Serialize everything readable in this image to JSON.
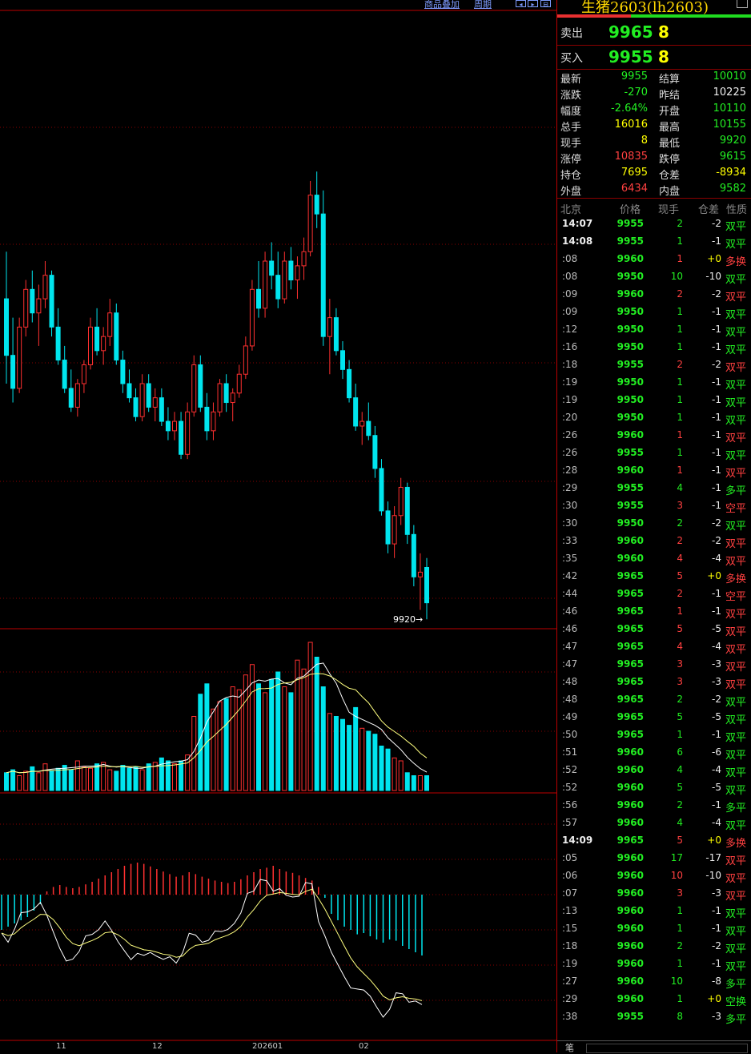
{
  "toolbar": {
    "link1": "商品叠加",
    "link2": "周期"
  },
  "x_axis_labels": [
    "11",
    "12",
    "202601",
    "02"
  ],
  "price_marker": "9920",
  "quote_panel": {
    "title": "生猪2603(lh2603)",
    "sell_label": "卖出",
    "sell_price": "9965",
    "sell_vol": "8",
    "buy_label": "买入",
    "buy_price": "9955",
    "buy_vol": "8",
    "stats": [
      {
        "l1": "最新",
        "v1": "9955",
        "c1": "g",
        "l2": "结算",
        "v2": "10010",
        "c2": "g"
      },
      {
        "l1": "涨跌",
        "v1": "-270",
        "c1": "g",
        "l2": "昨结",
        "v2": "10225",
        "c2": "w"
      },
      {
        "l1": "幅度",
        "v1": "-2.64%",
        "c1": "g",
        "l2": "开盘",
        "v2": "10110",
        "c2": "g"
      },
      {
        "l1": "总手",
        "v1": "16016",
        "c1": "y",
        "l2": "最高",
        "v2": "10155",
        "c2": "g"
      },
      {
        "l1": "现手",
        "v1": "8",
        "c1": "y",
        "l2": "最低",
        "v2": "9920",
        "c2": "g"
      },
      {
        "l1": "涨停",
        "v1": "10835",
        "c1": "r",
        "l2": "跌停",
        "v2": "9615",
        "c2": "g"
      },
      {
        "l1": "持仓",
        "v1": "7695",
        "c1": "y",
        "l2": "仓差",
        "v2": "-8934",
        "c2": "y"
      },
      {
        "l1": "外盘",
        "v1": "6434",
        "c1": "r",
        "l2": "内盘",
        "v2": "9582",
        "c2": "g"
      }
    ],
    "table_headers": [
      "北京",
      "价格",
      "现手",
      "仓差",
      "性质"
    ],
    "ticks": [
      {
        "time": "14:07",
        "price": "9955",
        "vol": "2",
        "oi": "-2",
        "nature": "双平",
        "vc": "g",
        "nc": "g"
      },
      {
        "time": "14:08",
        "price": "9955",
        "vol": "1",
        "oi": "-1",
        "nature": "双平",
        "vc": "g",
        "nc": "g"
      },
      {
        "time": ":08",
        "price": "9960",
        "vol": "1",
        "oi": "+0",
        "nature": "多换",
        "vc": "r",
        "nc": "r"
      },
      {
        "time": ":08",
        "price": "9950",
        "vol": "10",
        "oi": "-10",
        "nature": "双平",
        "vc": "g",
        "nc": "g"
      },
      {
        "time": ":09",
        "price": "9960",
        "vol": "2",
        "oi": "-2",
        "nature": "双平",
        "vc": "r",
        "nc": "r"
      },
      {
        "time": ":09",
        "price": "9950",
        "vol": "1",
        "oi": "-1",
        "nature": "双平",
        "vc": "g",
        "nc": "g"
      },
      {
        "time": ":12",
        "price": "9950",
        "vol": "1",
        "oi": "-1",
        "nature": "双平",
        "vc": "g",
        "nc": "g"
      },
      {
        "time": ":16",
        "price": "9950",
        "vol": "1",
        "oi": "-1",
        "nature": "双平",
        "vc": "g",
        "nc": "g"
      },
      {
        "time": ":18",
        "price": "9955",
        "vol": "2",
        "oi": "-2",
        "nature": "双平",
        "vc": "r",
        "nc": "r"
      },
      {
        "time": ":19",
        "price": "9950",
        "vol": "1",
        "oi": "-1",
        "nature": "双平",
        "vc": "g",
        "nc": "g"
      },
      {
        "time": ":19",
        "price": "9950",
        "vol": "1",
        "oi": "-1",
        "nature": "双平",
        "vc": "g",
        "nc": "g"
      },
      {
        "time": ":20",
        "price": "9950",
        "vol": "1",
        "oi": "-1",
        "nature": "双平",
        "vc": "g",
        "nc": "g"
      },
      {
        "time": ":26",
        "price": "9960",
        "vol": "1",
        "oi": "-1",
        "nature": "双平",
        "vc": "r",
        "nc": "r"
      },
      {
        "time": ":26",
        "price": "9955",
        "vol": "1",
        "oi": "-1",
        "nature": "双平",
        "vc": "g",
        "nc": "g"
      },
      {
        "time": ":28",
        "price": "9960",
        "vol": "1",
        "oi": "-1",
        "nature": "双平",
        "vc": "r",
        "nc": "r"
      },
      {
        "time": ":29",
        "price": "9955",
        "vol": "4",
        "oi": "-1",
        "nature": "多平",
        "vc": "g",
        "nc": "g"
      },
      {
        "time": ":30",
        "price": "9955",
        "vol": "3",
        "oi": "-1",
        "nature": "空平",
        "vc": "r",
        "nc": "r"
      },
      {
        "time": ":30",
        "price": "9950",
        "vol": "2",
        "oi": "-2",
        "nature": "双平",
        "vc": "g",
        "nc": "g"
      },
      {
        "time": ":33",
        "price": "9960",
        "vol": "2",
        "oi": "-2",
        "nature": "双平",
        "vc": "r",
        "nc": "r"
      },
      {
        "time": ":35",
        "price": "9960",
        "vol": "4",
        "oi": "-4",
        "nature": "双平",
        "vc": "r",
        "nc": "r"
      },
      {
        "time": ":42",
        "price": "9965",
        "vol": "5",
        "oi": "+0",
        "nature": "多换",
        "vc": "r",
        "nc": "r"
      },
      {
        "time": ":44",
        "price": "9965",
        "vol": "2",
        "oi": "-1",
        "nature": "空平",
        "vc": "r",
        "nc": "r"
      },
      {
        "time": ":46",
        "price": "9965",
        "vol": "1",
        "oi": "-1",
        "nature": "双平",
        "vc": "r",
        "nc": "r"
      },
      {
        "time": ":46",
        "price": "9965",
        "vol": "5",
        "oi": "-5",
        "nature": "双平",
        "vc": "r",
        "nc": "r"
      },
      {
        "time": ":47",
        "price": "9965",
        "vol": "4",
        "oi": "-4",
        "nature": "双平",
        "vc": "r",
        "nc": "r"
      },
      {
        "time": ":47",
        "price": "9965",
        "vol": "3",
        "oi": "-3",
        "nature": "双平",
        "vc": "r",
        "nc": "r"
      },
      {
        "time": ":48",
        "price": "9965",
        "vol": "3",
        "oi": "-3",
        "nature": "双平",
        "vc": "r",
        "nc": "r"
      },
      {
        "time": ":48",
        "price": "9965",
        "vol": "2",
        "oi": "-2",
        "nature": "双平",
        "vc": "g",
        "nc": "g"
      },
      {
        "time": ":49",
        "price": "9965",
        "vol": "5",
        "oi": "-5",
        "nature": "双平",
        "vc": "g",
        "nc": "g"
      },
      {
        "time": ":50",
        "price": "9965",
        "vol": "1",
        "oi": "-1",
        "nature": "双平",
        "vc": "g",
        "nc": "g"
      },
      {
        "time": ":51",
        "price": "9960",
        "vol": "6",
        "oi": "-6",
        "nature": "双平",
        "vc": "g",
        "nc": "g"
      },
      {
        "time": ":52",
        "price": "9960",
        "vol": "4",
        "oi": "-4",
        "nature": "双平",
        "vc": "g",
        "nc": "g"
      },
      {
        "time": ":52",
        "price": "9960",
        "vol": "5",
        "oi": "-5",
        "nature": "双平",
        "vc": "g",
        "nc": "g"
      },
      {
        "time": ":56",
        "price": "9960",
        "vol": "2",
        "oi": "-1",
        "nature": "多平",
        "vc": "g",
        "nc": "g"
      },
      {
        "time": ":57",
        "price": "9960",
        "vol": "4",
        "oi": "-4",
        "nature": "双平",
        "vc": "g",
        "nc": "g"
      },
      {
        "time": "14:09",
        "price": "9965",
        "vol": "5",
        "oi": "+0",
        "nature": "多换",
        "vc": "r",
        "nc": "r"
      },
      {
        "time": ":05",
        "price": "9960",
        "vol": "17",
        "oi": "-17",
        "nature": "双平",
        "vc": "g",
        "nc": "r"
      },
      {
        "time": ":06",
        "price": "9960",
        "vol": "10",
        "oi": "-10",
        "nature": "双平",
        "vc": "r",
        "nc": "r"
      },
      {
        "time": ":07",
        "price": "9960",
        "vol": "3",
        "oi": "-3",
        "nature": "双平",
        "vc": "r",
        "nc": "r"
      },
      {
        "time": ":13",
        "price": "9960",
        "vol": "1",
        "oi": "-1",
        "nature": "双平",
        "vc": "g",
        "nc": "g"
      },
      {
        "time": ":15",
        "price": "9960",
        "vol": "1",
        "oi": "-1",
        "nature": "双平",
        "vc": "g",
        "nc": "g"
      },
      {
        "time": ":18",
        "price": "9960",
        "vol": "2",
        "oi": "-2",
        "nature": "双平",
        "vc": "g",
        "nc": "g"
      },
      {
        "time": ":19",
        "price": "9960",
        "vol": "1",
        "oi": "-1",
        "nature": "双平",
        "vc": "g",
        "nc": "g"
      },
      {
        "time": ":27",
        "price": "9960",
        "vol": "10",
        "oi": "-8",
        "nature": "多平",
        "vc": "g",
        "nc": "g"
      },
      {
        "time": ":29",
        "price": "9960",
        "vol": "1",
        "oi": "+0",
        "nature": "空换",
        "vc": "g",
        "nc": "g"
      },
      {
        "time": ":38",
        "price": "9955",
        "vol": "8",
        "oi": "-3",
        "nature": "多平",
        "vc": "g",
        "nc": "g"
      }
    ],
    "bottom_tab": "笔"
  },
  "colors": {
    "up": "#ff3030",
    "down": "#00e5ee",
    "grid": "#8a0000",
    "ma_white": "#ffffff",
    "ma_yellow": "#ffff80"
  },
  "chart_data": {
    "type": "candlestick",
    "price_range": [
      9900,
      11200
    ],
    "candles": [
      [
        10600,
        10700,
        10420,
        10480
      ],
      [
        10480,
        10560,
        10380,
        10410
      ],
      [
        10410,
        10560,
        10400,
        10540
      ],
      [
        10540,
        10640,
        10520,
        10620
      ],
      [
        10620,
        10660,
        10550,
        10570
      ],
      [
        10570,
        10630,
        10500,
        10600
      ],
      [
        10600,
        10680,
        10580,
        10650
      ],
      [
        10650,
        10660,
        10520,
        10540
      ],
      [
        10540,
        10580,
        10460,
        10470
      ],
      [
        10470,
        10500,
        10400,
        10410
      ],
      [
        10410,
        10450,
        10360,
        10370
      ],
      [
        10370,
        10430,
        10350,
        10420
      ],
      [
        10420,
        10470,
        10400,
        10460
      ],
      [
        10460,
        10560,
        10450,
        10540
      ],
      [
        10540,
        10580,
        10480,
        10490
      ],
      [
        10490,
        10540,
        10460,
        10520
      ],
      [
        10520,
        10600,
        10500,
        10570
      ],
      [
        10570,
        10590,
        10460,
        10470
      ],
      [
        10470,
        10490,
        10400,
        10420
      ],
      [
        10420,
        10450,
        10380,
        10390
      ],
      [
        10390,
        10410,
        10340,
        10350
      ],
      [
        10350,
        10440,
        10340,
        10420
      ],
      [
        10420,
        10440,
        10360,
        10370
      ],
      [
        10370,
        10410,
        10340,
        10390
      ],
      [
        10390,
        10410,
        10330,
        10340
      ],
      [
        10340,
        10370,
        10300,
        10320
      ],
      [
        10320,
        10360,
        10300,
        10340
      ],
      [
        10340,
        10360,
        10260,
        10270
      ],
      [
        10270,
        10380,
        10260,
        10360
      ],
      [
        10360,
        10480,
        10350,
        10460
      ],
      [
        10460,
        10480,
        10360,
        10370
      ],
      [
        10370,
        10400,
        10300,
        10320
      ],
      [
        10320,
        10380,
        10300,
        10360
      ],
      [
        10360,
        10430,
        10350,
        10420
      ],
      [
        10420,
        10440,
        10360,
        10380
      ],
      [
        10380,
        10410,
        10340,
        10400
      ],
      [
        10400,
        10460,
        10390,
        10440
      ],
      [
        10440,
        10520,
        10430,
        10500
      ],
      [
        10500,
        10640,
        10490,
        10620
      ],
      [
        10620,
        10680,
        10560,
        10580
      ],
      [
        10580,
        10700,
        10560,
        10680
      ],
      [
        10680,
        10720,
        10620,
        10650
      ],
      [
        10650,
        10700,
        10580,
        10600
      ],
      [
        10600,
        10700,
        10590,
        10680
      ],
      [
        10680,
        10710,
        10620,
        10640
      ],
      [
        10640,
        10690,
        10600,
        10670
      ],
      [
        10670,
        10730,
        10640,
        10700
      ],
      [
        10700,
        10850,
        10690,
        10820
      ],
      [
        10820,
        10870,
        10750,
        10780
      ],
      [
        10780,
        10830,
        10500,
        10520
      ],
      [
        10520,
        10600,
        10440,
        10560
      ],
      [
        10560,
        10580,
        10480,
        10490
      ],
      [
        10490,
        10510,
        10430,
        10450
      ],
      [
        10450,
        10470,
        10380,
        10390
      ],
      [
        10390,
        10420,
        10320,
        10330
      ],
      [
        10330,
        10360,
        10290,
        10340
      ],
      [
        10340,
        10380,
        10300,
        10310
      ],
      [
        10310,
        10330,
        10220,
        10240
      ],
      [
        10240,
        10260,
        10140,
        10150
      ],
      [
        10150,
        10170,
        10060,
        10080
      ],
      [
        10080,
        10160,
        10050,
        10140
      ],
      [
        10140,
        10220,
        10120,
        10200
      ],
      [
        10200,
        10210,
        10080,
        10100
      ],
      [
        10100,
        10120,
        9990,
        10010
      ],
      [
        10010,
        10060,
        9940,
        10020
      ],
      [
        10030,
        10050,
        9920,
        9955
      ]
    ],
    "volume_ratio": [
      0.12,
      0.14,
      0.1,
      0.13,
      0.16,
      0.12,
      0.18,
      0.13,
      0.15,
      0.17,
      0.14,
      0.2,
      0.16,
      0.15,
      0.18,
      0.19,
      0.14,
      0.13,
      0.17,
      0.15,
      0.16,
      0.14,
      0.18,
      0.19,
      0.22,
      0.2,
      0.18,
      0.2,
      0.24,
      0.5,
      0.65,
      0.72,
      0.55,
      0.6,
      0.62,
      0.7,
      0.68,
      0.78,
      0.85,
      0.72,
      0.66,
      0.75,
      0.8,
      0.7,
      0.66,
      0.88,
      0.82,
      1.0,
      0.9,
      0.7,
      0.52,
      0.5,
      0.48,
      0.44,
      0.56,
      0.42,
      0.4,
      0.38,
      0.3,
      0.28,
      0.22,
      0.2,
      0.12,
      0.1,
      0.1,
      0.1
    ],
    "macd_hist": [
      -0.55,
      -0.5,
      -0.45,
      -0.4,
      -0.35,
      -0.25,
      -0.15,
      0.05,
      0.12,
      0.15,
      0.12,
      0.1,
      0.12,
      0.16,
      0.2,
      0.25,
      0.3,
      0.35,
      0.4,
      0.45,
      0.48,
      0.5,
      0.48,
      0.44,
      0.4,
      0.36,
      0.32,
      0.28,
      0.3,
      0.35,
      0.32,
      0.28,
      0.25,
      0.22,
      0.2,
      0.18,
      0.2,
      0.24,
      0.3,
      0.35,
      0.4,
      0.42,
      0.45,
      0.4,
      0.36,
      0.34,
      0.3,
      0.26,
      0.22,
      0.12,
      -0.05,
      -0.3,
      -0.4,
      -0.5,
      -0.55,
      -0.62,
      -0.6,
      -0.65,
      -0.7,
      -0.75,
      -0.7,
      -0.72,
      -0.8,
      -0.85,
      -0.9,
      -0.95
    ],
    "xlabels": [
      "11",
      "12",
      "202601",
      "02"
    ]
  }
}
